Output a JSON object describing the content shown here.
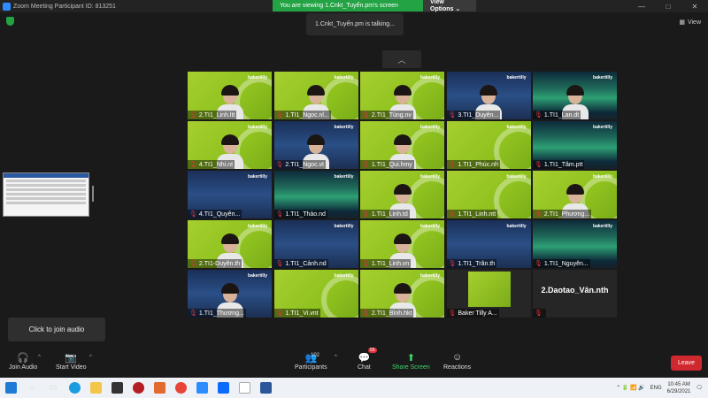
{
  "window": {
    "title": "Zoom Meeting Participant ID: 813251",
    "controls": [
      "—",
      "□",
      "✕"
    ]
  },
  "banner": {
    "viewing": "You are viewing 1.Cnkt_Tuyến.pm's screen",
    "view_options": "View Options ⌄"
  },
  "view_button": "View",
  "talking": "1.Cnkt_Tuyến.pm is talking...",
  "tiles": [
    {
      "name": "2.TI1_Linh.ltt",
      "style": "green",
      "person": true
    },
    {
      "name": "1.TI1_Ngoc.nl...",
      "style": "green",
      "person": true
    },
    {
      "name": "2.TI1_Tùng.nv",
      "style": "green",
      "person": true
    },
    {
      "name": "3.TI1_Duyên...",
      "style": "night",
      "person": true
    },
    {
      "name": "1.TI1_Lan.dt",
      "style": "aurora",
      "person": true
    },
    {
      "name": "4.TI1_Nhi.nt",
      "style": "green",
      "person": true
    },
    {
      "name": "2.TI1_Ngoc.vt",
      "style": "night",
      "person": true
    },
    {
      "name": "1.TI1_Qui.hmy",
      "style": "green",
      "person": true
    },
    {
      "name": "1.TI1_Phúc.nh",
      "style": "green",
      "person": false
    },
    {
      "name": "1.TI1_Tâm.ptt",
      "style": "aurora",
      "person": false
    },
    {
      "name": "4.TI1_Quyên...",
      "style": "night",
      "person": false
    },
    {
      "name": "1.TI1_Thảo.nd",
      "style": "aurora",
      "person": false
    },
    {
      "name": "1.TI1_Linh.td",
      "style": "green",
      "person": true
    },
    {
      "name": "1.TI1_Linh.ntt",
      "style": "green",
      "person": false
    },
    {
      "name": "2.TI1_Phương...",
      "style": "green",
      "person": true
    },
    {
      "name": "2.TI1-Duyên.th",
      "style": "green",
      "person": true
    },
    {
      "name": "1.TI1_Cảnh.nd",
      "style": "night",
      "person": false
    },
    {
      "name": "1.TI1_Linh.vn",
      "style": "green",
      "person": true
    },
    {
      "name": "1.TI1_Trân.th",
      "style": "night",
      "person": false
    },
    {
      "name": "1.TI1_Nguyên...",
      "style": "aurora",
      "person": false
    },
    {
      "name": "1.TI1_Thương...",
      "style": "night",
      "person": true
    },
    {
      "name": "1.TI1_Vi.vnt",
      "style": "green",
      "person": false
    },
    {
      "name": "2.TI1_Bình.hkt",
      "style": "green",
      "person": true
    },
    {
      "name": "Baker Tilly A...",
      "style": "card",
      "person": false
    },
    {
      "name": "2.Daotao_Vân.nth",
      "style": "dark",
      "person": false,
      "big": true
    }
  ],
  "brand_text": "bakertilly",
  "audio_tooltip": "Click to join audio",
  "toolbar": {
    "join_audio": "Join Audio",
    "start_video": "Start Video",
    "participants": "Participants",
    "participants_count": "102",
    "chat": "Chat",
    "chat_badge": "55",
    "share_screen": "Share Screen",
    "reactions": "Reactions",
    "leave": "Leave"
  },
  "tray": {
    "lang": "ENG",
    "time": "10:45 AM",
    "date": "6/29/2021"
  }
}
